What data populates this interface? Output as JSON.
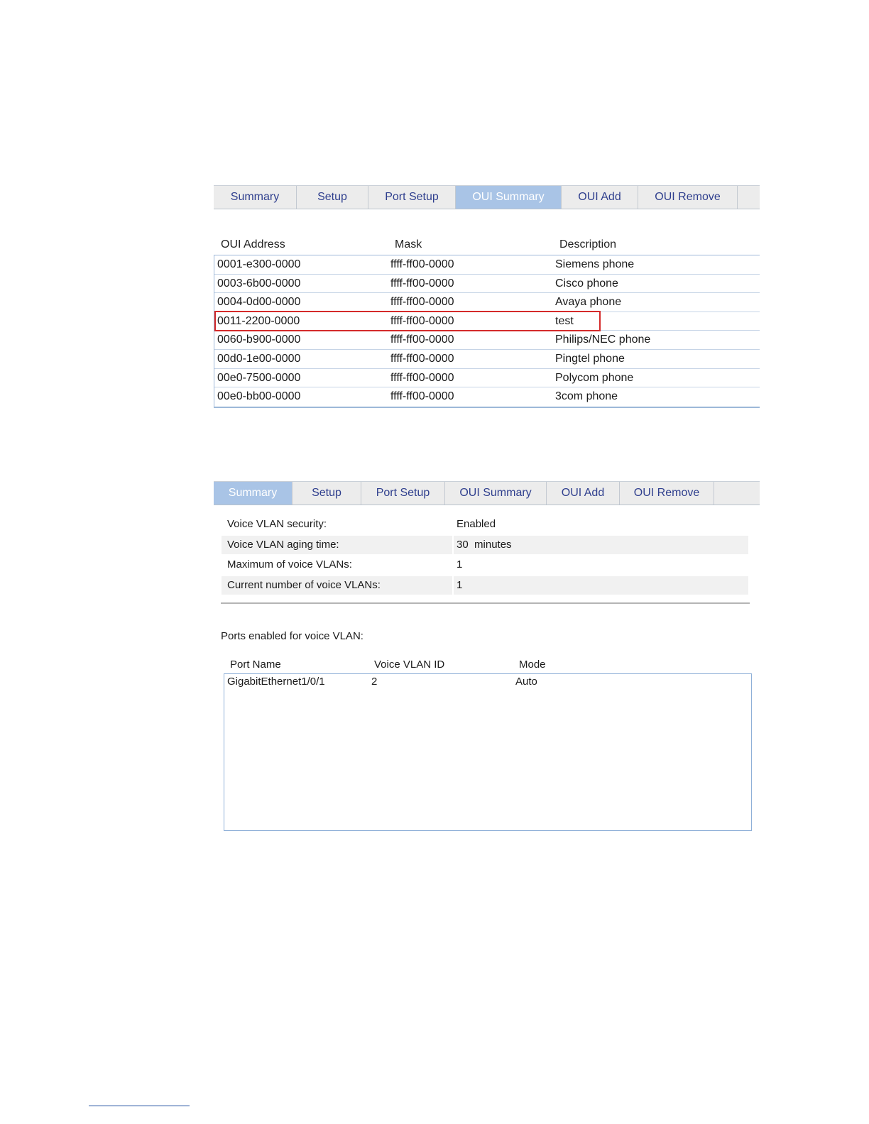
{
  "oui_panel": {
    "tabs": [
      "Summary",
      "Setup",
      "Port Setup",
      "OUI Summary",
      "OUI Add",
      "OUI Remove"
    ],
    "active_tab": "OUI Summary",
    "columns": [
      "OUI Address",
      "Mask",
      "Description"
    ],
    "rows": [
      {
        "address": "0001-e300-0000",
        "mask": "ffff-ff00-0000",
        "description": "Siemens phone"
      },
      {
        "address": "0003-6b00-0000",
        "mask": "ffff-ff00-0000",
        "description": "Cisco phone"
      },
      {
        "address": "0004-0d00-0000",
        "mask": "ffff-ff00-0000",
        "description": "Avaya phone"
      },
      {
        "address": "0011-2200-0000",
        "mask": "ffff-ff00-0000",
        "description": "test"
      },
      {
        "address": "0060-b900-0000",
        "mask": "ffff-ff00-0000",
        "description": "Philips/NEC phone"
      },
      {
        "address": "00d0-1e00-0000",
        "mask": "ffff-ff00-0000",
        "description": "Pingtel phone"
      },
      {
        "address": "00e0-7500-0000",
        "mask": "ffff-ff00-0000",
        "description": "Polycom phone"
      },
      {
        "address": "00e0-bb00-0000",
        "mask": "ffff-ff00-0000",
        "description": "3com phone"
      }
    ],
    "highlighted_row": "0011-2200-0000"
  },
  "summary_panel": {
    "tabs": [
      "Summary",
      "Setup",
      "Port Setup",
      "OUI Summary",
      "OUI Add",
      "OUI Remove"
    ],
    "active_tab": "Summary",
    "settings": [
      {
        "label": "Voice VLAN security:",
        "value": "Enabled"
      },
      {
        "label": "Voice VLAN aging time:",
        "value": "30  minutes"
      },
      {
        "label": "Maximum of voice VLANs:",
        "value": "1"
      },
      {
        "label": "Current number of voice VLANs:",
        "value": "1"
      }
    ],
    "ports_title": "Ports enabled for voice VLAN:",
    "port_columns": [
      "Port Name",
      "Voice VLAN ID",
      "Mode"
    ],
    "ports": [
      {
        "name": "GigabitEthernet1/0/1",
        "vlan_id": "2",
        "mode": "Auto"
      }
    ]
  },
  "colors": {
    "active_tab": "#a9c4e6",
    "tab_text": "#2f3f8e",
    "highlight": "#d42a2a",
    "table_border": "#9db8d8"
  }
}
